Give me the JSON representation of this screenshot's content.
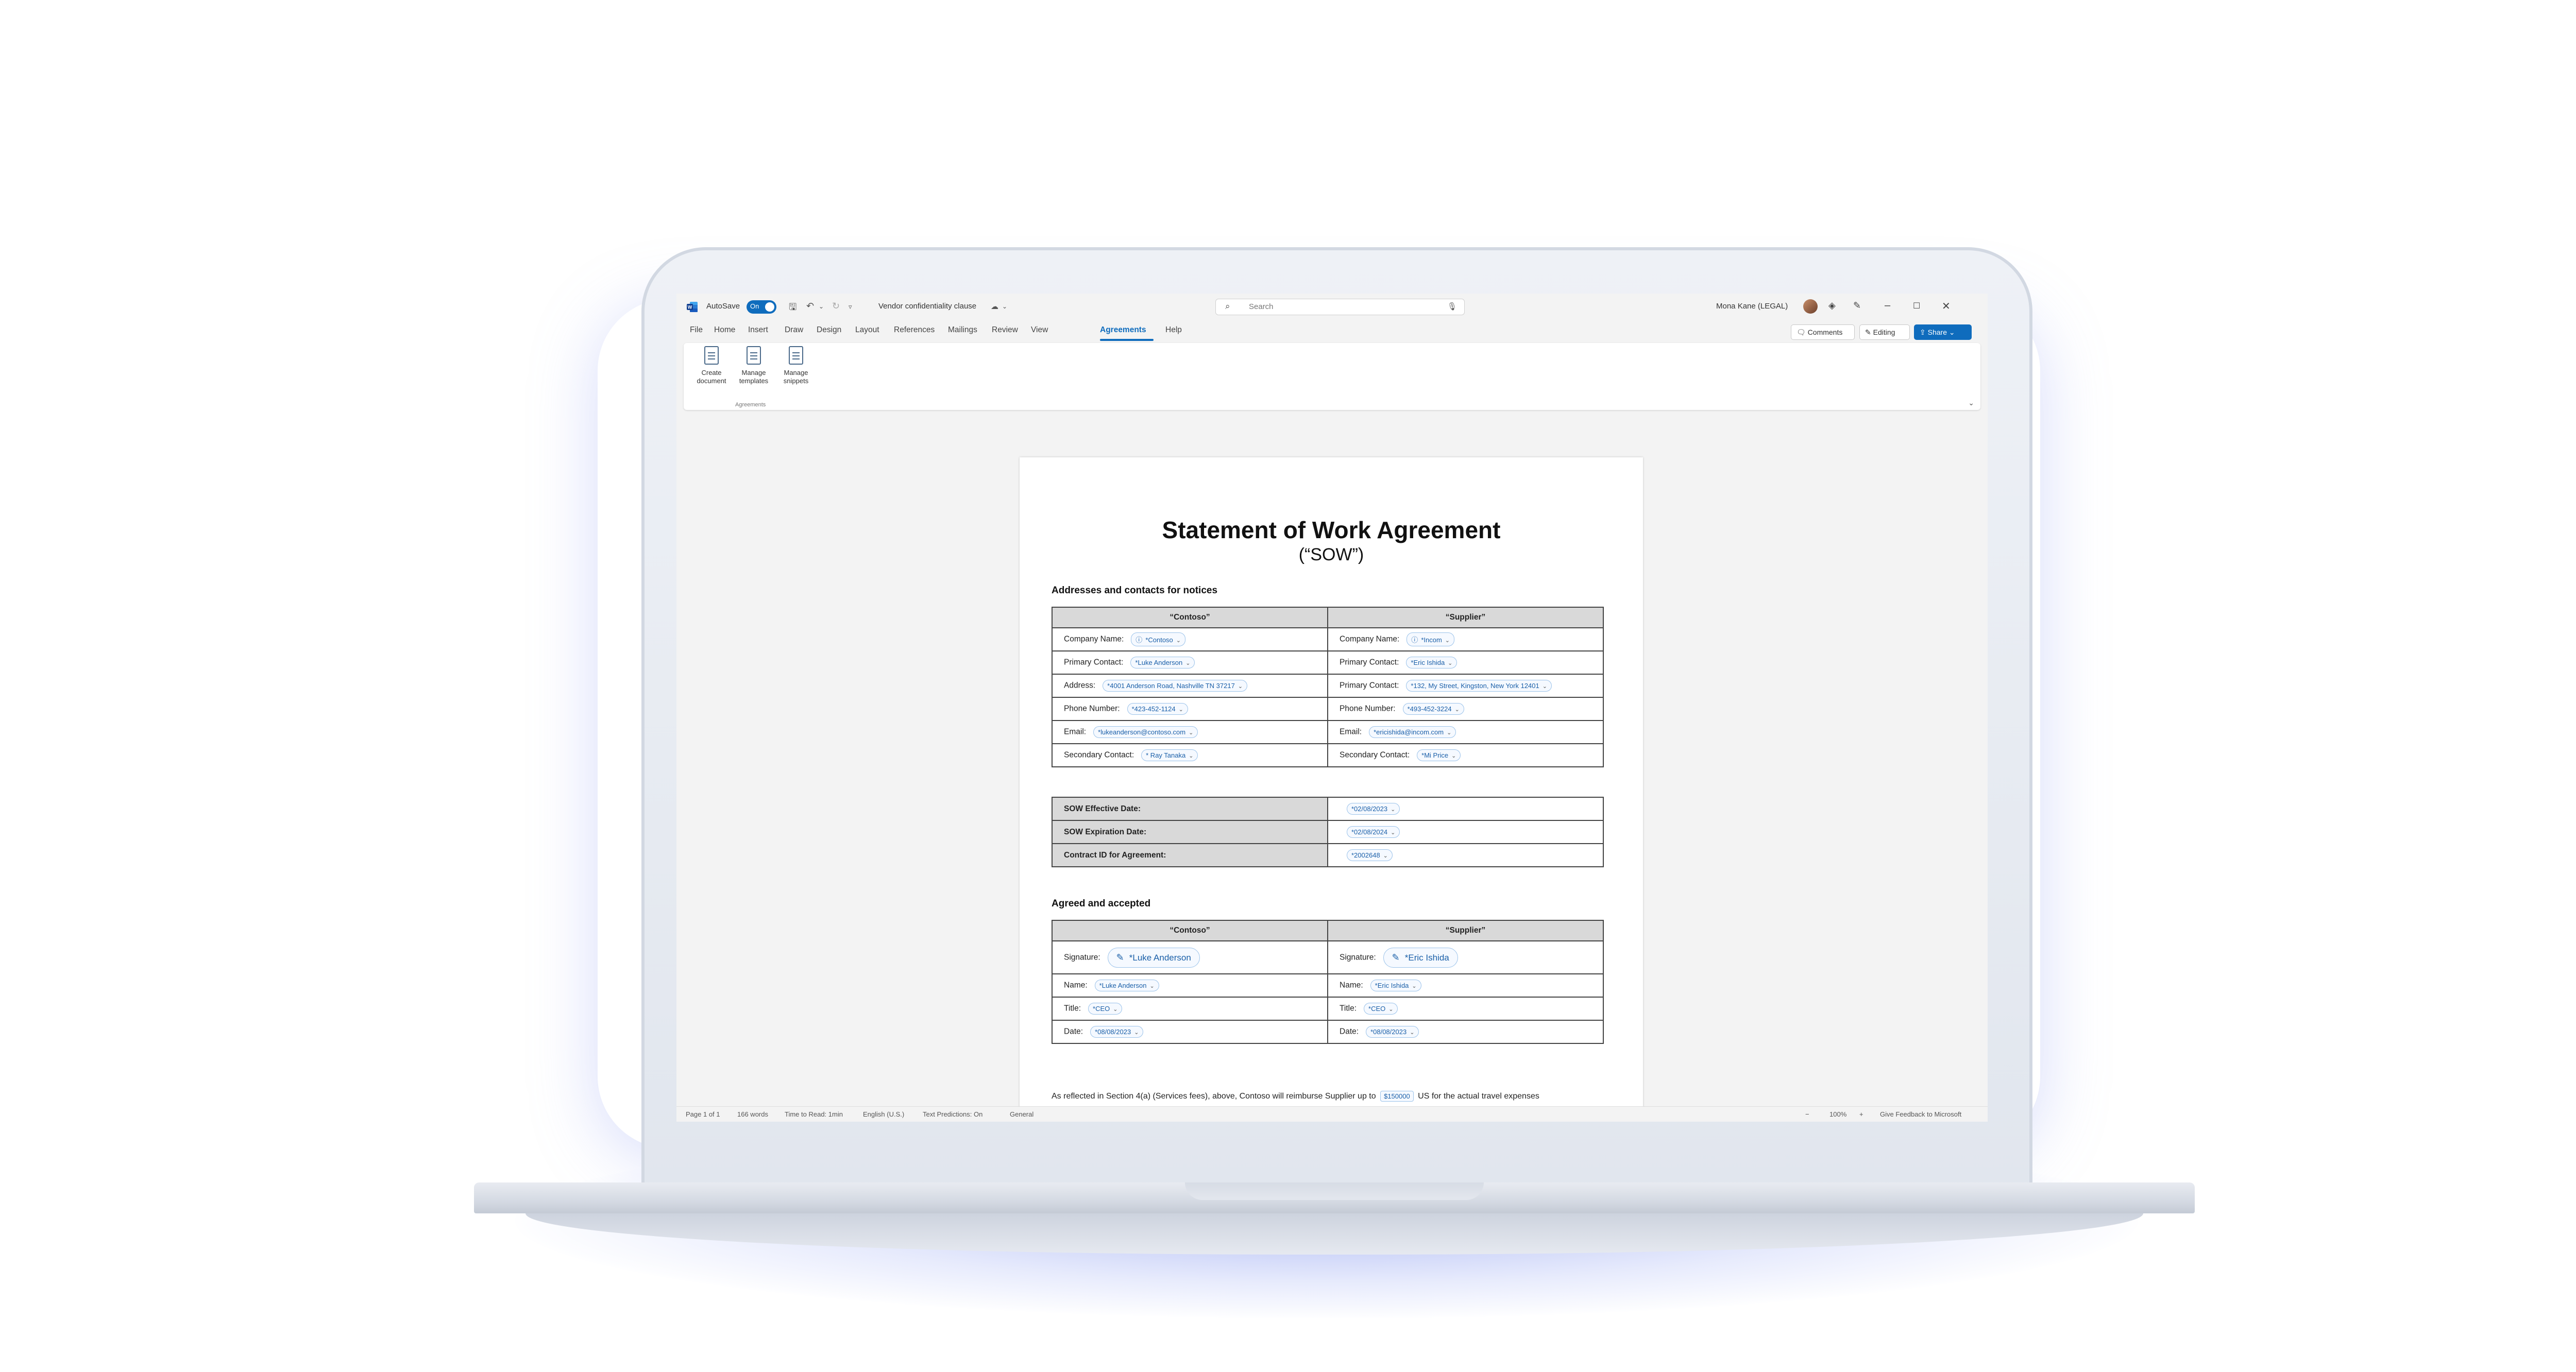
{
  "titlebar": {
    "autosave_label": "AutoSave",
    "autosave_state": "On",
    "document_name": "Vendor confidentiality clause",
    "search_placeholder": "Search",
    "user_name": "Mona Kane (LEGAL)"
  },
  "menu": {
    "tabs": [
      "File",
      "Home",
      "Insert",
      "Draw",
      "Design",
      "Layout",
      "References",
      "Mailings",
      "Review",
      "View",
      "Agreements",
      "Help"
    ],
    "active_tab": "Agreements",
    "comments_label": "Comments",
    "editing_label": "Editing",
    "share_label": "Share"
  },
  "ribbon": {
    "buttons": [
      {
        "line1": "Create",
        "line2": "document"
      },
      {
        "line1": "Manage",
        "line2": "templates"
      },
      {
        "line1": "Manage",
        "line2": "snippets"
      }
    ],
    "group_label": "Agreements"
  },
  "document": {
    "title": "Statement of Work Agreement",
    "subtitle": "(“SOW”)",
    "section1_heading": "Addresses and contacts for notices",
    "party_headers": [
      "“Contoso”",
      "“Supplier”"
    ],
    "contacts": [
      {
        "left_label": "Company Name:",
        "left_value": "*Contoso",
        "right_label": "Company Name:",
        "right_value": "*Incom"
      },
      {
        "left_label": "Primary Contact:",
        "left_value": "*Luke Anderson",
        "right_label": "Primary Contact:",
        "right_value": "*Eric Ishida"
      },
      {
        "left_label": "Address:",
        "left_value": "*4001 Anderson Road, Nashville TN 37217",
        "right_label": "Primary Contact:",
        "right_value": "*132, My Street, Kingston, New York 12401"
      },
      {
        "left_label": "Phone Number:",
        "left_value": "*423-452-1124",
        "right_label": "Phone Number:",
        "right_value": "*493-452-3224"
      },
      {
        "left_label": "Email:",
        "left_value": "*lukeanderson@contoso.com",
        "right_label": "Email:",
        "right_value": "*ericishida@incom.com"
      },
      {
        "left_label": "Secondary Contact:",
        "left_value": "* Ray Tanaka",
        "right_label": "Secondary Contact:",
        "right_value": "*Mi Price"
      }
    ],
    "sow_rows": [
      {
        "label": "SOW Effective Date:",
        "value": "*02/08/2023"
      },
      {
        "label": "SOW Expiration Date:",
        "value": "*02/08/2024"
      },
      {
        "label": "Contract ID for Agreement:",
        "value": "*2002648"
      }
    ],
    "section2_heading": "Agreed and accepted",
    "signature_label": "Signature:",
    "signatures": [
      "*Luke Anderson",
      "*Eric Ishida"
    ],
    "accept_rows": [
      {
        "left_label": "Name:",
        "left_value": "*Luke Anderson",
        "right_label": "Name:",
        "right_value": "*Eric Ishida"
      },
      {
        "left_label": "Title:",
        "left_value": "*CEO",
        "right_label": "Title:",
        "right_value": "*CEO"
      },
      {
        "left_label": "Date:",
        "left_value": "*08/08/2023",
        "right_label": "Date:",
        "right_value": "*08/08/2023"
      }
    ],
    "para_before": "As reflected in Section 4(a) (Services fees), above, Contoso will reimburse Supplier up to",
    "para_amount": "$150000",
    "para_after": "US for the actual travel expenses"
  },
  "statusbar": {
    "page": "Page 1 of 1",
    "words": "166 words",
    "read_time": "Time to Read: 1min",
    "language": "English (U.S.)",
    "predictions": "Text Predictions: On",
    "sensitivity": "General",
    "zoom": "100%",
    "feedback": "Give Feedback to Microsoft"
  },
  "colors": {
    "accent": "#0f6cbd",
    "table_header": "#d9d9d9",
    "content_control": "#1a5fa8"
  }
}
